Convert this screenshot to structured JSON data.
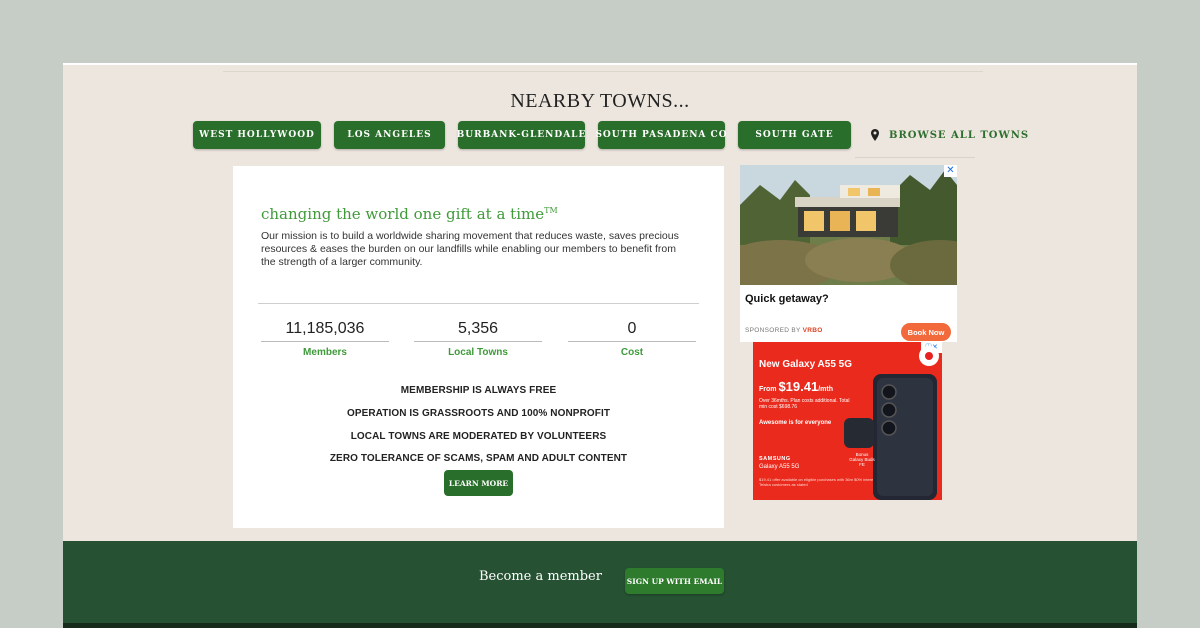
{
  "nearby": {
    "title": "NEARBY TOWNS...",
    "towns": [
      "WEST HOLLYWOOD",
      "LOS ANGELES",
      "BURBANK-GLENDALE",
      "SOUTH PASADENA CO",
      "SOUTH GATE"
    ],
    "browse_all": "BROWSE ALL TOWNS"
  },
  "mission": {
    "tagline": "changing the world one gift at a time",
    "tm": "TM",
    "text": "Our mission is to build a worldwide sharing movement that reduces waste, saves precious resources & eases the burden on our landfills while enabling our members to benefit from the strength of a larger community."
  },
  "stats": [
    {
      "value": "11,185,036",
      "label": "Members"
    },
    {
      "value": "5,356",
      "label": "Local Towns"
    },
    {
      "value": "0",
      "label": "Cost"
    }
  ],
  "features": [
    "MEMBERSHIP IS ALWAYS FREE",
    "OPERATION IS GRASSROOTS AND 100% NONPROFIT",
    "LOCAL TOWNS ARE MODERATED BY VOLUNTEERS",
    "ZERO TOLERANCE OF SCAMS, SPAM AND ADULT CONTENT"
  ],
  "learn_more": "LEARN MORE",
  "ad1": {
    "headline": "Quick getaway?",
    "sponsored_prefix": "SPONSORED BY",
    "sponsor": "VRBO",
    "cta": "Book Now",
    "close": "✕"
  },
  "ad2": {
    "title": "New Galaxy A55 5G",
    "price_prefix": "From ",
    "price": "$19.41",
    "price_suffix": "/mth",
    "fine": "Over 36mths. Plan costs additional. Total min cost $698.76",
    "awesome": "Awesome is for everyone",
    "brand": "SAMSUNG",
    "model": "Galaxy A55 5G",
    "bonus": "Bonus Galaxy Buds FE",
    "legal": "$19.41 offer available on eligible purchases with 36m $0% interest for Telstra customers as stated",
    "close": "ⓘ✕"
  },
  "footer": {
    "become_member": "Become a member",
    "signup": "SIGN UP WITH EMAIL"
  },
  "colors": {
    "brand_green": "#2a6e2b",
    "accent_green": "#3f9a3a",
    "footer_green": "#265233",
    "page_bg": "#ede6de",
    "outer_bg": "#c6cdc6",
    "ad_red": "#ea2a1c",
    "ad_orange": "#f26a3c"
  }
}
